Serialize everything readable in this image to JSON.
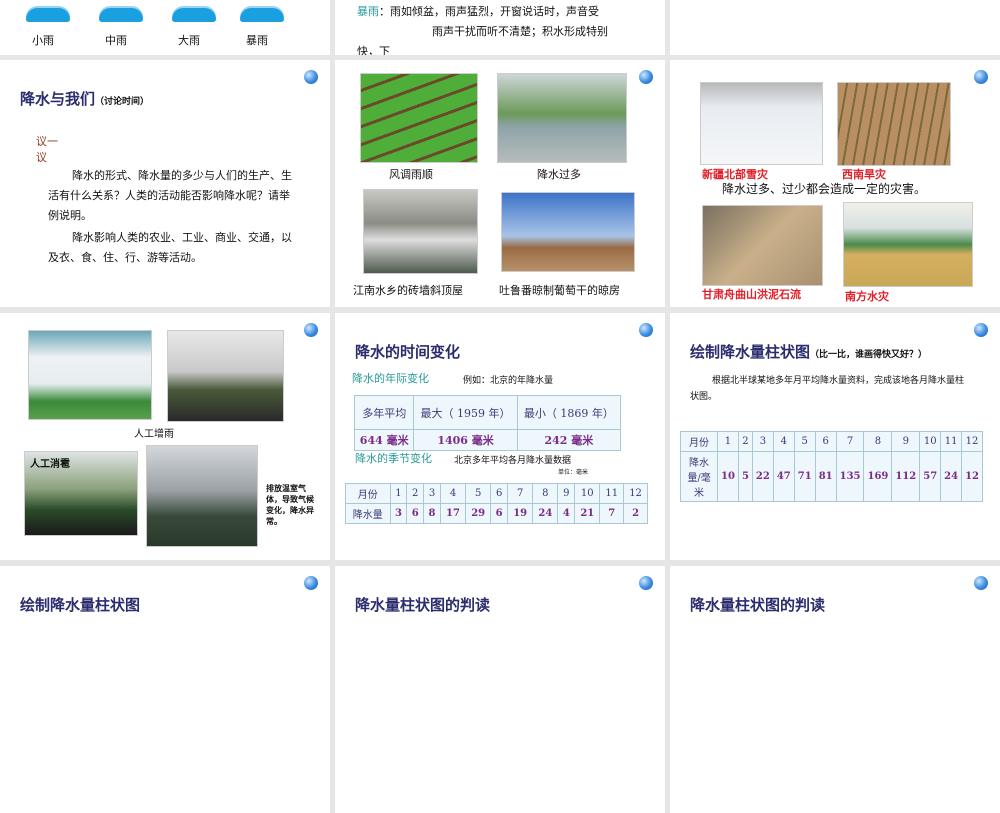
{
  "slide1": {
    "rain_types": [
      "小雨",
      "中雨",
      "大雨",
      "暴雨"
    ]
  },
  "slide2": {
    "label": "暴雨",
    "text1": "：雨如倾盆，雨声猛烈，开窗说话时，声音受",
    "text2": "雨声干扰而听不清楚；积水形成特别",
    "text3": "快，下"
  },
  "slide4": {
    "title": "降水与我们",
    "subtitle": "（讨论时间）",
    "discuss": "议一议",
    "p1": "降水的形式、降水量的多少与人们的生产、生活有什么关系？人类的活动能否影响降水呢？请举例说明。",
    "p2": "降水影响人类的农业、工业、商业、交通，以及衣、食、住、行、游等活动。"
  },
  "slide5": {
    "captions": [
      "风调雨顺",
      "降水过多",
      "江南水乡的砖墙斜顶屋",
      "吐鲁番晾制葡萄干的晾房"
    ]
  },
  "slide6": {
    "captions": [
      "新疆北部雪灾",
      "西南旱灾",
      "甘肃舟曲山洪泥石流",
      "南方水灾"
    ],
    "note": "降水过多、过少都会造成一定的灾害。"
  },
  "slide7": {
    "caption_rain": "人工增雨",
    "caption_hail": "人工消雹",
    "note": "排放温室气体，导致气候变化，降水异常。"
  },
  "slide8": {
    "title": "降水的时间变化",
    "annual_label": "降水的年际变化",
    "annual_example": "例如：北京的年降水量",
    "annual_headers": [
      "多年平均",
      "最大（ 1959 年）",
      "最小（ 1869 年）"
    ],
    "annual_values": [
      "644 毫米",
      "1406 毫米",
      "242  毫米"
    ],
    "seasonal_label": "降水的季节变化",
    "seasonal_title": "北京多年平均各月降水量数据",
    "unit": "单位：毫米",
    "row_month": "月份",
    "row_precip": "降水量",
    "months": [
      "1",
      "2",
      "3",
      "4",
      "5",
      "6",
      "7",
      "8",
      "9",
      "10",
      "11",
      "12"
    ],
    "values": [
      "3",
      "6",
      "8",
      "17",
      "29",
      "6",
      "19",
      "24",
      "4",
      "21",
      "7",
      "2"
    ]
  },
  "slide9": {
    "title": "绘制降水量柱状图",
    "subtitle": "（比一比，谁画得快又好？）",
    "text": "根据北半球某地多年月平均降水量资料，完成该地各月降水量柱状图。",
    "row_month": "月份",
    "row_precip": "降水量/毫米",
    "months": [
      "1",
      "2",
      "3",
      "4",
      "5",
      "6",
      "7",
      "8",
      "9",
      "10",
      "11",
      "12"
    ],
    "values": [
      "10",
      "5",
      "22",
      "47",
      "71",
      "81",
      "135",
      "169",
      "112",
      "57",
      "24",
      "12"
    ]
  },
  "slide10": {
    "title": "绘制降水量柱状图"
  },
  "slide11": {
    "title": "降水量柱状图的判读"
  },
  "slide12": {
    "title": "降水量柱状图的判读"
  }
}
